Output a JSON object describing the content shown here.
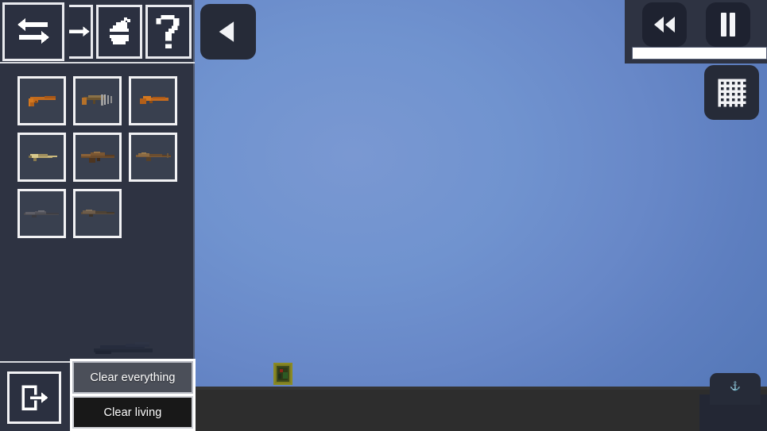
{
  "app": {
    "title": "Sandbox Weapon Spawner"
  },
  "toolbar": {
    "items": [
      {
        "label": "Swap / Transfer",
        "icon": "swap-arrows-icon",
        "state": "selected"
      },
      {
        "label": "Move Right",
        "icon": "arrow-right-icon",
        "state": "clipped"
      },
      {
        "label": "Grenade",
        "icon": "grenade-icon",
        "state": "normal"
      },
      {
        "label": "Help",
        "icon": "question-mark-icon",
        "state": "normal"
      }
    ]
  },
  "weapon_grid": {
    "columns": 3,
    "slots": [
      {
        "index": 1,
        "label": "Pistol",
        "icon": "pistol-icon",
        "tint": "#c26a1c"
      },
      {
        "index": 2,
        "label": "Machine Pistol",
        "icon": "machine-pistol-icon",
        "tint": "#9a6a33"
      },
      {
        "index": 3,
        "label": "Sawed-off Shotgun",
        "icon": "sawed-off-icon",
        "tint": "#c46a1e"
      },
      {
        "index": 4,
        "label": "Submachine Gun",
        "icon": "smg-icon",
        "tint": "#b6a472"
      },
      {
        "index": 5,
        "label": "Assault Rifle",
        "icon": "assault-rifle-icon",
        "tint": "#6b4b2c"
      },
      {
        "index": 6,
        "label": "Battle Rifle",
        "icon": "battle-rifle-icon",
        "tint": "#7b5a38"
      },
      {
        "index": 7,
        "label": "Sniper Rifle",
        "icon": "sniper-rifle-icon",
        "tint": "#4a4a50"
      },
      {
        "index": 8,
        "label": "Heavy Rifle",
        "icon": "heavy-rifle-icon",
        "tint": "#5a4c3e"
      }
    ]
  },
  "sidebar_bottom": {
    "exit_label": "Exit",
    "exit_icon": "exit-door-icon"
  },
  "clear_menu": {
    "buttons": [
      {
        "label": "Clear everything",
        "style": "translucent"
      },
      {
        "label": "Clear living",
        "style": "solid"
      }
    ]
  },
  "world_controls": {
    "back": {
      "label": "Back",
      "icon": "triangle-left-icon"
    },
    "grid": {
      "label": "Toggle Grid",
      "icon": "grid-icon"
    }
  },
  "playback": {
    "rewind": {
      "label": "Rewind",
      "icon": "rewind-icon"
    },
    "pause": {
      "label": "Pause",
      "icon": "pause-icon"
    },
    "progress_percent": 100
  },
  "bottom_right": {
    "label": "Drawer",
    "icon": "anchor-icon",
    "glyph": "⚓"
  },
  "world": {
    "sky_top_color": "#7a98d2",
    "sky_edge_color": "#5578b8",
    "ground_color": "#2d2d2d",
    "entity": {
      "label": "Crate Entity",
      "color": "#8a8a24"
    }
  },
  "colors": {
    "panel": "#2e3342",
    "panel_dark": "#1e2230",
    "border_light": "#f2f2f4",
    "accent_white": "#ffffff"
  }
}
